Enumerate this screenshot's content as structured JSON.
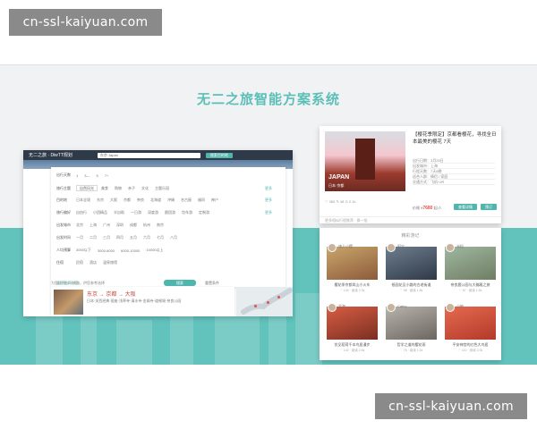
{
  "watermark": {
    "text": "cn-ssl-kaiyuan.com"
  },
  "headline": "无二之旅智能方案系统",
  "browser": {
    "logo": "无二之旅 · DiwTT规划",
    "search_value": "东京 Japan",
    "search_button": "搜索目的地",
    "filters": [
      {
        "label": "出行天数",
        "options": [
          "1",
          "3—",
          "5",
          "7+"
        ]
      },
      {
        "label": "旅行主题",
        "options": [
          "自然风光",
          "美食",
          "购物",
          "亲子",
          "文化",
          "主题乐园"
        ]
      },
      {
        "label": "目的地",
        "options": [
          "日本全境",
          "东京",
          "大阪",
          "京都",
          "奈良",
          "北海道",
          "冲绳",
          "名古屋",
          "福冈",
          "神户"
        ]
      },
      {
        "label": "旅行偏好",
        "options": [
          "自由行",
          "小团精品",
          "半自助",
          "一日游",
          "深度游",
          "跟团游",
          "包车游",
          "定制游"
        ]
      },
      {
        "label": "出发城市",
        "options": [
          "北京",
          "上海",
          "广州",
          "深圳",
          "成都",
          "杭州",
          "南京"
        ]
      },
      {
        "label": "出发时间",
        "options": [
          "一月",
          "二月",
          "三月",
          "四月",
          "五月",
          "六月",
          "七月",
          "八月"
        ]
      },
      {
        "label": "人均预算",
        "options": [
          "3000以下",
          "3000-6000",
          "6000-10000",
          "10000以上"
        ]
      },
      {
        "label": "住宿",
        "options": [
          "民宿",
          "酒店",
          "温泉旅馆"
        ]
      }
    ],
    "more_label": "更多",
    "advanced_label": "展开更多选项",
    "submit_label": "搜索",
    "reset_label": "重置条件",
    "result_note": "为您找到以下线路，供您参考选择",
    "result_title": "东京 → 京都 → 大阪",
    "result_sub": "日本·关西经典·银座·浅草寺·清水寺·金阁寺·道顿堀·奈良公园"
  },
  "feature": {
    "title": "【樱花季限定】京都看樱花，寻找全日本最美的樱花 7天",
    "image_label": "JAPAN",
    "image_sub": "日本·京都",
    "details": [
      "出行日期：3月25日",
      "出发城市：上海",
      "行程天数：7天6晚",
      "适合人群：情侣 / 家庭",
      "交通方式：飞机+JR"
    ],
    "meta": "♡ 365  ✎ 48  ⊙ 2.1k",
    "price_label": "价格 ¥",
    "price": "7680",
    "price_suffix": "起/人",
    "btn_detail": "查看详情",
    "btn_book": "预订",
    "footer": "更多相似行程推荐 · 换一批"
  },
  "gallery": {
    "title": "精彩游记",
    "tiles": [
      {
        "user": "旅人小樱",
        "caption": "樱花季京都岚山小火车",
        "stats": "♡ 126 · 阅读 2.3k",
        "palette": "#c9a66b,#8d5a3b"
      },
      {
        "user": "阿宝",
        "caption": "祇园花见小路的古老街道",
        "stats": "♡ 98 · 阅读 1.8k",
        "palette": "#6e7d8d,#2f3a48"
      },
      {
        "user": "米粒",
        "caption": "奈良鹿公园与大佛殿之旅",
        "stats": "♡ 87 · 阅读 1.5k",
        "palette": "#9fb7a0,#6f7e63"
      },
      {
        "user": "北海",
        "caption": "伏见稻荷千本鸟居漫步",
        "stats": "♡ 142 · 阅读 2.6k",
        "palette": "#d85d44,#7a2f22"
      },
      {
        "user": "Cathy",
        "caption": "哲学之道的樱花雨",
        "stats": "♡ 76 · 阅读 1.2k",
        "palette": "#b7b3ac,#6c6660"
      },
      {
        "user": "小柚",
        "caption": "平安神宫的红色大鸟居",
        "stats": "♡ 110 · 阅读 2.0k",
        "palette": "#e76a4f,#b23a2a"
      }
    ]
  }
}
